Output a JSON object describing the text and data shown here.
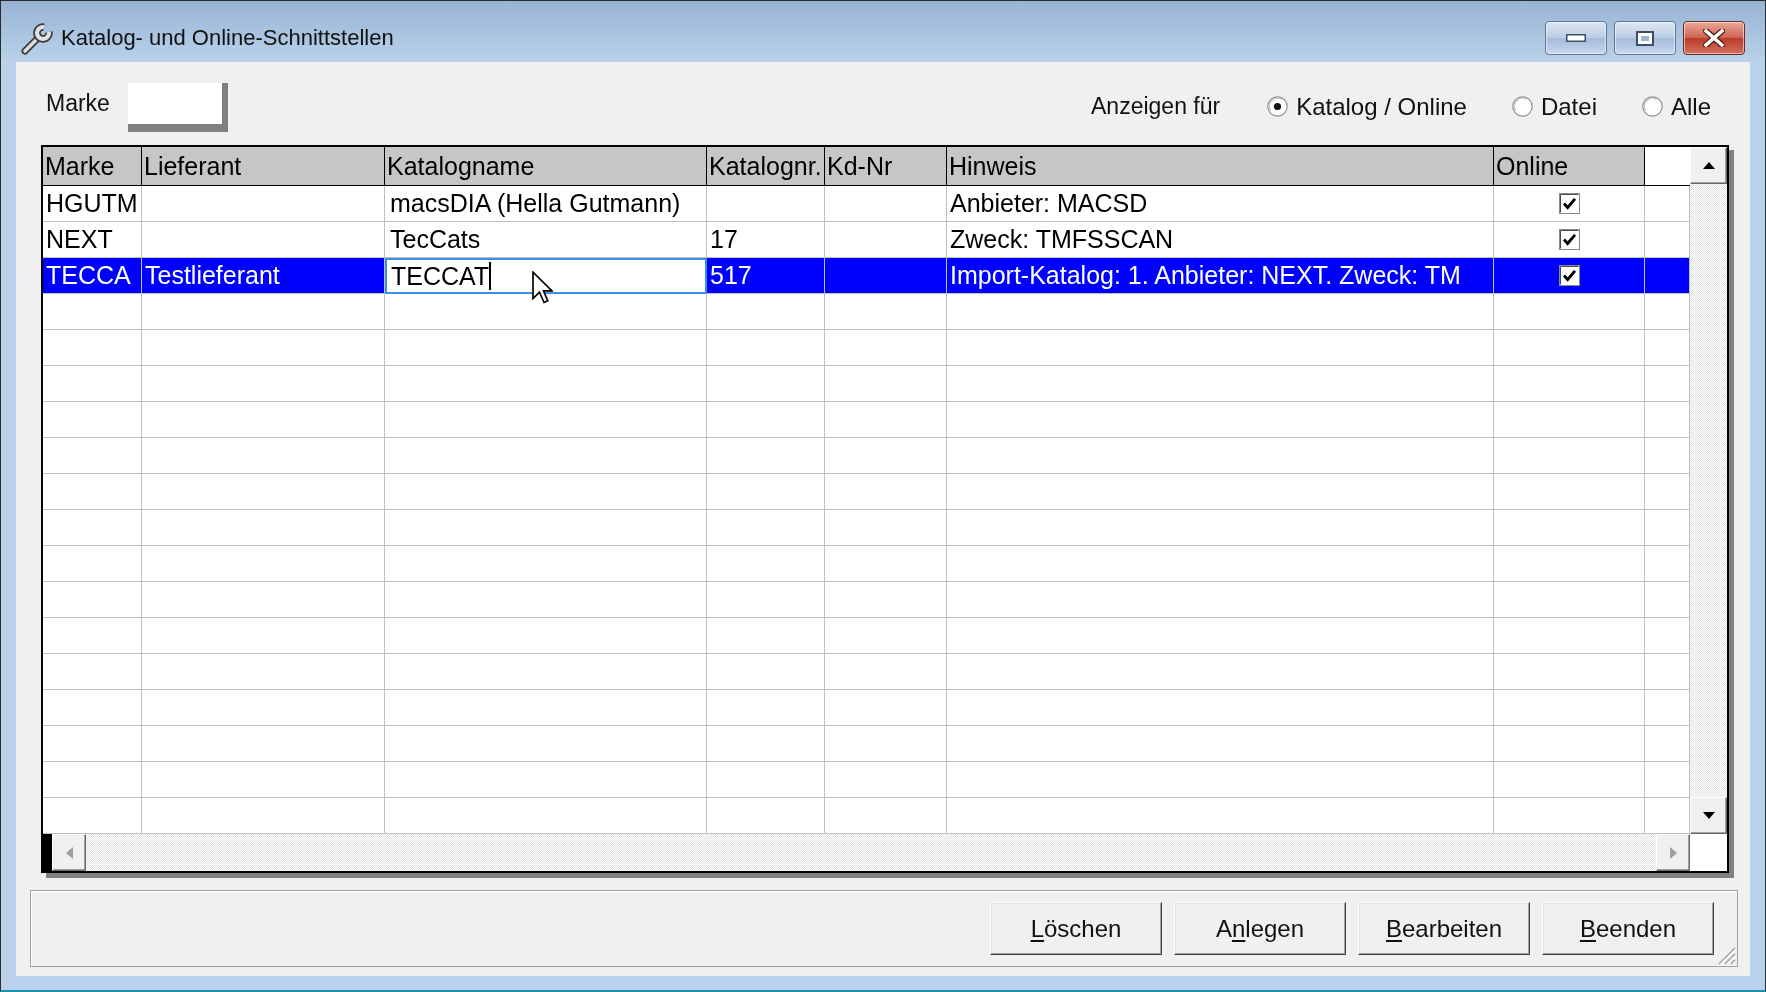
{
  "window": {
    "title": "Katalog- und Online-Schnittstellen"
  },
  "marke_filter": {
    "label": "Marke"
  },
  "display_filter": {
    "label": "Anzeigen für",
    "options": [
      {
        "label": "Katalog / Online",
        "selected": true
      },
      {
        "label": "Datei",
        "selected": false
      },
      {
        "label": "Alle",
        "selected": false
      }
    ]
  },
  "table": {
    "columns": [
      {
        "title": "Marke",
        "kind": "text"
      },
      {
        "title": "Lieferant",
        "kind": "text"
      },
      {
        "title": "Katalogname",
        "kind": "text"
      },
      {
        "title": "Katalognr.",
        "kind": "text"
      },
      {
        "title": "Kd-Nr",
        "kind": "text"
      },
      {
        "title": "Hinweis",
        "kind": "text"
      },
      {
        "title": "Online",
        "kind": "checkbox"
      }
    ],
    "rows": [
      {
        "selected": false,
        "katalogname_editing": false,
        "marke": "HGUTM",
        "katalogname": "macsDIA (Hella Gutmann)",
        "hinweis": "Anbieter: MACSD",
        "online": true
      },
      {
        "selected": false,
        "katalogname_editing": false,
        "marke": "NEXT",
        "katalogname": "TecCats",
        "katalognr": "17",
        "hinweis": "Zweck: TMFSSCAN",
        "online": true
      },
      {
        "selected": true,
        "katalogname_editing": true,
        "marke": "TECCA",
        "lieferant": "Testlieferant",
        "katalogname": "TECCAT",
        "katalognr": "517",
        "hinweis": "Import-Katalog: 1. Anbieter: NEXT. Zweck: TM",
        "online": true
      }
    ]
  },
  "buttons": [
    {
      "label_parts": [
        {
          "text": "L",
          "underlined": true
        },
        {
          "text": "öschen",
          "underlined": false
        }
      ]
    },
    {
      "label_parts": [
        {
          "text": "A",
          "underlined": false
        },
        {
          "text": "n",
          "underlined": true
        },
        {
          "text": "legen",
          "underlined": false
        }
      ]
    },
    {
      "label_parts": [
        {
          "text": "B",
          "underlined": true
        },
        {
          "text": "earbeiten",
          "underlined": false
        }
      ]
    },
    {
      "label_parts": [
        {
          "text": "B",
          "underlined": true
        },
        {
          "text": "eenden",
          "underlined": false
        }
      ]
    }
  ]
}
